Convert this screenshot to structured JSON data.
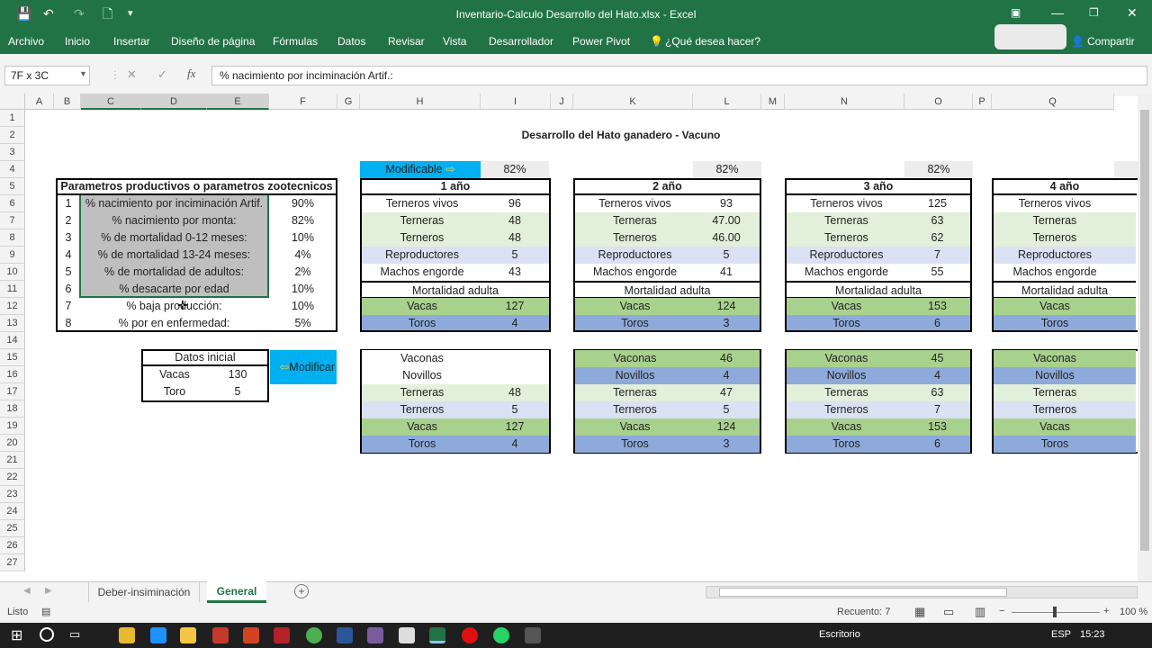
{
  "window": {
    "title": "Inventario-Calculo Desarrollo del Hato.xlsx - Excel"
  },
  "qat": {
    "save": "💾",
    "undo": "↶",
    "redo": "↷",
    "new": "🗋",
    "more": "▾"
  },
  "ribbon": {
    "tabs": [
      "Archivo",
      "Inicio",
      "Insertar",
      "Diseño de página",
      "Fórmulas",
      "Datos",
      "Revisar",
      "Vista",
      "Desarrollador",
      "Power Pivot"
    ],
    "tell_me": "¿Qué desea hacer?",
    "share": "Compartir"
  },
  "formula_bar": {
    "name_box": "7F x 3C",
    "formula": "% nacimiento por inciminación Artif.:"
  },
  "columns": [
    "A",
    "B",
    "C",
    "D",
    "E",
    "F",
    "G",
    "H",
    "I",
    "J",
    "K",
    "L",
    "M",
    "N",
    "O",
    "P",
    "Q"
  ],
  "rows": [
    "1",
    "2",
    "3",
    "4",
    "5",
    "6",
    "7",
    "8",
    "9",
    "10",
    "11",
    "12",
    "13",
    "14",
    "15",
    "16",
    "17",
    "18",
    "19",
    "20",
    "21",
    "22",
    "23",
    "24",
    "25",
    "26",
    "27"
  ],
  "sheet": {
    "title": "Desarrollo del Hato ganadero - Vacuno",
    "params_header": "Parametros productivos o parametros zootecnicos",
    "params": [
      {
        "n": "1",
        "label": "% nacimiento por inciminación Artif.",
        "value": "90%"
      },
      {
        "n": "2",
        "label": "% nacimiento por monta:",
        "value": "82%"
      },
      {
        "n": "3",
        "label": "% de mortalidad 0-12 meses:",
        "value": "10%"
      },
      {
        "n": "4",
        "label": "% de mortalidad 13-24 meses:",
        "value": "4%"
      },
      {
        "n": "5",
        "label": "% de mortalidad de adultos:",
        "value": "2%"
      },
      {
        "n": "6",
        "label": "% desacarte por edad",
        "value": "10%"
      },
      {
        "n": "7",
        "label": "% baja producción:",
        "value": "10%"
      },
      {
        "n": "8",
        "label": "% por en enfermedad:",
        "value": "5%"
      }
    ],
    "datos_inicial": {
      "header": "Datos inicial",
      "vacas_label": "Vacas",
      "vacas": "130",
      "toro_label": "Toro",
      "toro": "5"
    },
    "modificar_button": "Modificar",
    "modificable_label": "Modificable",
    "years": [
      {
        "pct": "82%",
        "header": "1 año",
        "top": [
          [
            "Terneros vivos",
            "96"
          ],
          [
            "Terneras",
            "48"
          ],
          [
            "Terneros",
            "48"
          ],
          [
            "Reproductores",
            "5"
          ],
          [
            "Machos engorde",
            "43"
          ]
        ],
        "mort": "Mortalidad adulta",
        "vacas": [
          "Vacas",
          "127"
        ],
        "toros": [
          "Toros",
          "4"
        ],
        "bottom": [
          [
            "Vaconas",
            ""
          ],
          [
            "Novillos",
            ""
          ],
          [
            "Terneras",
            "48"
          ],
          [
            "Terneros",
            "5"
          ],
          [
            "Vacas",
            "127"
          ],
          [
            "Toros",
            "4"
          ]
        ]
      },
      {
        "pct": "82%",
        "header": "2 año",
        "top": [
          [
            "Terneros vivos",
            "93"
          ],
          [
            "Terneras",
            "47.00"
          ],
          [
            "Terneros",
            "46.00"
          ],
          [
            "Reproductores",
            "5"
          ],
          [
            "Machos engorde",
            "41"
          ]
        ],
        "mort": "Mortalidad adulta",
        "vacas": [
          "Vacas",
          "124"
        ],
        "toros": [
          "Toros",
          "3"
        ],
        "bottom": [
          [
            "Vaconas",
            "46"
          ],
          [
            "Novillos",
            "4"
          ],
          [
            "Terneras",
            "47"
          ],
          [
            "Terneros",
            "5"
          ],
          [
            "Vacas",
            "124"
          ],
          [
            "Toros",
            "3"
          ]
        ]
      },
      {
        "pct": "82%",
        "header": "3 año",
        "top": [
          [
            "Terneros vivos",
            "125"
          ],
          [
            "Terneras",
            "63"
          ],
          [
            "Terneros",
            "62"
          ],
          [
            "Reproductores",
            "7"
          ],
          [
            "Machos engorde",
            "55"
          ]
        ],
        "mort": "Mortalidad adulta",
        "vacas": [
          "Vacas",
          "153"
        ],
        "toros": [
          "Toros",
          "6"
        ],
        "bottom": [
          [
            "Vaconas",
            "45"
          ],
          [
            "Novillos",
            "4"
          ],
          [
            "Terneras",
            "63"
          ],
          [
            "Terneros",
            "7"
          ],
          [
            "Vacas",
            "153"
          ],
          [
            "Toros",
            "6"
          ]
        ]
      },
      {
        "pct": "",
        "header": "4 año",
        "top": [
          [
            "Terneros vivos",
            ""
          ],
          [
            "Terneras",
            ""
          ],
          [
            "Terneros",
            ""
          ],
          [
            "Reproductores",
            ""
          ],
          [
            "Machos engorde",
            ""
          ]
        ],
        "mort": "Mortalidad adulta",
        "vacas": [
          "Vacas",
          ""
        ],
        "toros": [
          "Toros",
          ""
        ],
        "bottom": [
          [
            "Vaconas",
            ""
          ],
          [
            "Novillos",
            ""
          ],
          [
            "Terneras",
            ""
          ],
          [
            "Terneros",
            ""
          ],
          [
            "Vacas",
            ""
          ],
          [
            "Toros",
            ""
          ]
        ]
      }
    ]
  },
  "sheet_tabs": [
    "Deber-insiminación",
    "General"
  ],
  "active_sheet": "General",
  "status": {
    "ready": "Listo",
    "count": "Recuento: 7",
    "zoom": "100 %"
  },
  "taskbar": {
    "desktop": "Escritorio",
    "lang": "ESP",
    "time": "15:23"
  },
  "colors": {
    "excel_green": "#217346",
    "green_fill": "#a9d18e",
    "blue_fill": "#8eaadb",
    "light_green": "#e2efda",
    "light_blue": "#d9e1f2",
    "cyan": "#00b0f0",
    "selection": "#bfbfbf"
  }
}
